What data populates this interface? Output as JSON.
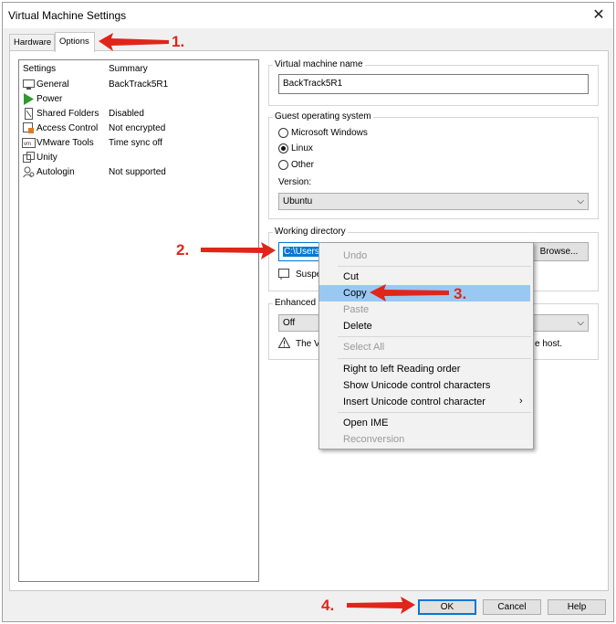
{
  "window": {
    "title": "Virtual Machine Settings"
  },
  "tabs": [
    {
      "label": "Hardware"
    },
    {
      "label": "Options"
    }
  ],
  "settings_list": {
    "header_settings": "Settings",
    "header_summary": "Summary",
    "items": [
      {
        "label": "General",
        "summary": "BackTrack5R1"
      },
      {
        "label": "Power",
        "summary": ""
      },
      {
        "label": "Shared Folders",
        "summary": "Disabled"
      },
      {
        "label": "Access Control",
        "summary": "Not encrypted"
      },
      {
        "label": "VMware Tools",
        "summary": "Time sync off"
      },
      {
        "label": "Unity",
        "summary": ""
      },
      {
        "label": "Autologin",
        "summary": "Not supported"
      }
    ]
  },
  "vm_name": {
    "title": "Virtual machine name",
    "value": "BackTrack5R1"
  },
  "guest_os": {
    "title": "Guest operating system",
    "options": [
      "Microsoft Windows",
      "Linux",
      "Other"
    ],
    "selected": "Linux",
    "version_label": "Version:",
    "version_value": "Ubuntu"
  },
  "working_dir": {
    "title": "Working directory",
    "value": "C:\\Users\\",
    "browse": "Browse...",
    "suspend_text": "Suspe"
  },
  "enhanced": {
    "title": "Enhanced k",
    "value": "Off",
    "warning_left": "The V",
    "warning_right": "e host."
  },
  "context_menu": {
    "undo": "Undo",
    "cut": "Cut",
    "copy": "Copy",
    "paste": "Paste",
    "delete": "Delete",
    "select_all": "Select All",
    "rtl": "Right to left Reading order",
    "show_unicode": "Show Unicode control characters",
    "insert_unicode": "Insert Unicode control character",
    "open_ime": "Open IME",
    "reconversion": "Reconversion"
  },
  "buttons": {
    "ok": "OK",
    "cancel": "Cancel",
    "help": "Help"
  },
  "annotations": [
    "1.",
    "2.",
    "3.",
    "4."
  ],
  "colors": {
    "accent": "#0078d7",
    "highlight": "#99c9f3",
    "annotation": "#e0251b",
    "power": "#2e9a2e"
  }
}
